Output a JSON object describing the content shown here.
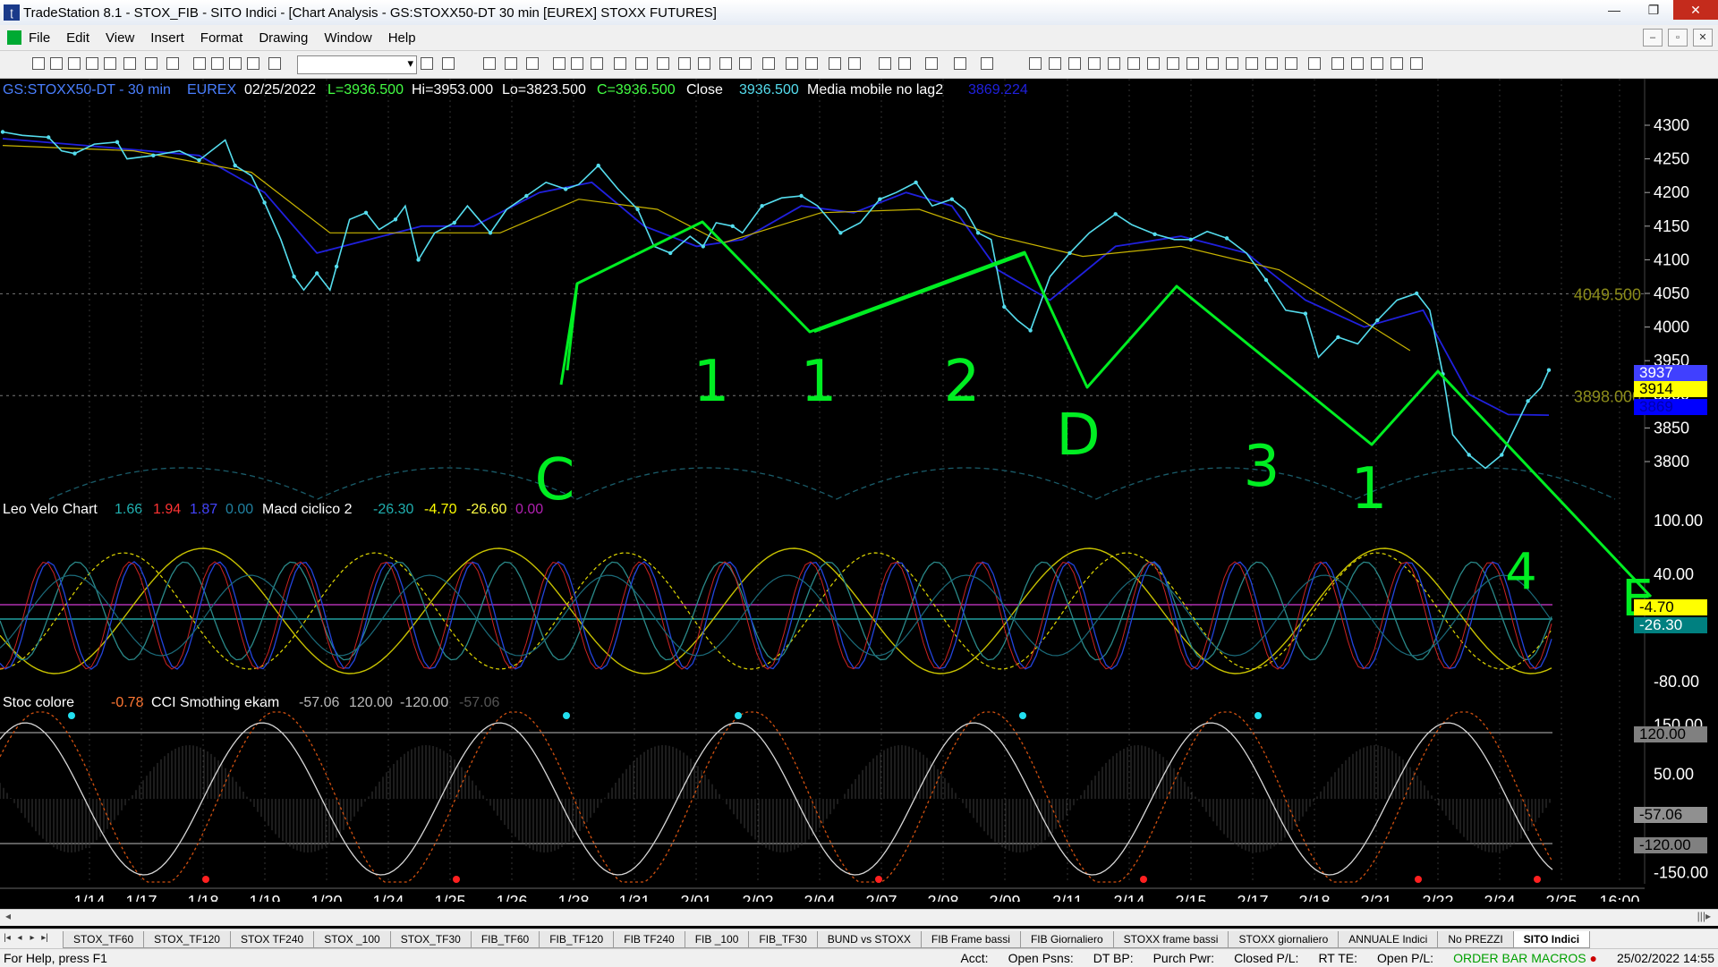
{
  "window": {
    "title": "TradeStation 8.1 - STOX_FIB - SITO Indici - [Chart Analysis - GS:STOXX50-DT  30 min  [EUREX] STOXX FUTURES]",
    "minimize": "—",
    "maximize": "❐",
    "close": "✕"
  },
  "menu": [
    "File",
    "Edit",
    "View",
    "Insert",
    "Format",
    "Drawing",
    "Window",
    "Help"
  ],
  "mdi_buttons": [
    "–",
    "▫",
    "✕"
  ],
  "chart": {
    "header": {
      "symbol": "GS:STOXX50-DT - 30 min",
      "exchange": "EUREX",
      "date": "02/25/2022",
      "last": "L=3936.500",
      "high": "Hi=3953.000",
      "low": "Lo=3823.500",
      "close": "C=3936.500",
      "close_label": "Close",
      "close_value": "3936.500",
      "ma_label": "Media mobile no lag2",
      "ma_value": "3869.224"
    },
    "price_axis": [
      "4300",
      "4250",
      "4200",
      "4150",
      "4100",
      "4050",
      "4000",
      "3950",
      "3900",
      "3850",
      "3800"
    ],
    "price_levels": [
      {
        "label": "4049.500",
        "value": 4049.5
      },
      {
        "label": "3898.000",
        "value": 3898.0
      }
    ],
    "price_boxes": [
      {
        "label": "3937",
        "bg": "#4040ff",
        "fg": "#ffffff"
      },
      {
        "label": "3914",
        "bg": "#ffff00",
        "fg": "#000000"
      },
      {
        "label": "3869",
        "bg": "#0000ff",
        "fg": "#0000aa"
      }
    ],
    "handwritten_labels": [
      "C",
      "1",
      "1",
      "2",
      "D",
      "3",
      "1",
      "4",
      "E"
    ],
    "panel2": {
      "title": "Leo Velo Chart",
      "v1": "1.66",
      "v2": "1.94",
      "v3": "1.87",
      "v4": "0.00",
      "macd_label": "Macd ciclico 2",
      "m1": "-26.30",
      "m2": "-4.70",
      "m3": "-26.60",
      "m4": "0.00",
      "axis": [
        "100.00",
        "40.00",
        "-80.00"
      ],
      "boxes": [
        {
          "label": "-4.70",
          "bg": "#ffff00",
          "fg": "#000000"
        },
        {
          "label": "-26.30",
          "bg": "#008080",
          "fg": "#ffffff"
        }
      ]
    },
    "panel3": {
      "title": "Stoc colore",
      "v1": "-0.78",
      "cci_label": "CCI Smothing ekam",
      "c1": "-57.06",
      "c2": "120.00",
      "c3": "-120.00",
      "c4": "-57.06",
      "axis": [
        "150.00",
        "50.00",
        "-150.00"
      ],
      "boxes": [
        {
          "label": "120.00",
          "bg": "#808080",
          "fg": "#000000"
        },
        {
          "label": "-57.06",
          "bg": "#909090",
          "fg": "#000000"
        },
        {
          "label": "-120.00",
          "bg": "#808080",
          "fg": "#000000"
        }
      ]
    },
    "date_axis": [
      "1/14",
      "1/17",
      "1/18",
      "1/19",
      "1/20",
      "1/24",
      "1/25",
      "1/26",
      "1/28",
      "1/31",
      "2/01",
      "2/02",
      "2/04",
      "2/07",
      "2/08",
      "2/09",
      "2/11",
      "2/14",
      "2/15",
      "2/17",
      "2/18",
      "2/21",
      "2/22",
      "2/24",
      "2/25",
      "16:00"
    ]
  },
  "scroll": {
    "left": "◂",
    "right": "|||▸"
  },
  "tab_nav": [
    "|◂",
    "◂",
    "▸",
    "▸|"
  ],
  "tabs": [
    "STOX_TF60",
    "STOX_TF120",
    "STOX TF240",
    "STOX _100",
    "STOX_TF30",
    "FIB_TF60",
    "FIB_TF120",
    "FIB TF240",
    "FIB _100",
    "FIB_TF30",
    "BUND vs STOXX",
    "FIB Frame bassi",
    "FIB Giornaliero",
    "STOXX frame bassi",
    "STOXX giornaliero",
    "ANNUALE Indici",
    "No PREZZI",
    "SITO Indici"
  ],
  "active_tab": "SITO Indici",
  "status": {
    "help": "For Help, press F1",
    "acct": "Acct:",
    "open_psns": "Open Psns:",
    "dt_bp": "DT BP:",
    "purch_pwr": "Purch Pwr:",
    "closed_pl": "Closed P/L:",
    "rt_te": "RT TE:",
    "open_pl": "Open P/L:",
    "order_bar": "ORDER BAR",
    "macros": "MACROS",
    "datetime": "25/02/2022 14:55"
  },
  "colors": {
    "price": "#55ddee",
    "ma_blue": "#2020dd",
    "ma_yellow": "#c8b400",
    "trend_green": "#00ee22",
    "level": "#8c8c1a"
  }
}
